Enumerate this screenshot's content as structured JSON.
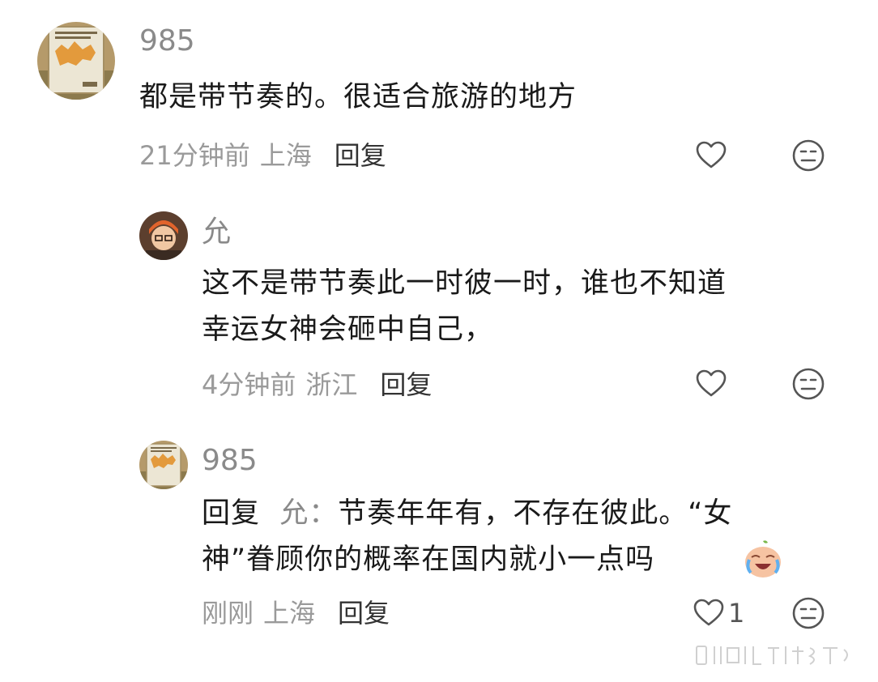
{
  "comments": [
    {
      "username": "985",
      "text": "都是带节奏的。很适合旅游的地方",
      "time": "21分钟前",
      "location": "上海",
      "reply_label": "回复",
      "likes": ""
    },
    {
      "username": "允",
      "text": "这不是带节奏此一时彼一时，谁也不知道\n幸运女神会砸中自己，",
      "time": "4分钟前",
      "location": "浙江",
      "reply_label": "回复",
      "likes": ""
    },
    {
      "username": "985",
      "reply_prefix": "回复",
      "reply_to": "允：",
      "text": "节奏年年有，不存在彼此。“女\n神”眷顾你的概率在国内就小一点吗",
      "time": "刚刚",
      "location": "上海",
      "reply_label": "回复",
      "likes": "1"
    }
  ],
  "icons": [
    "heart-icon",
    "neutral-face-icon",
    "crying-laugh-emoji",
    "weibo-watermark"
  ]
}
